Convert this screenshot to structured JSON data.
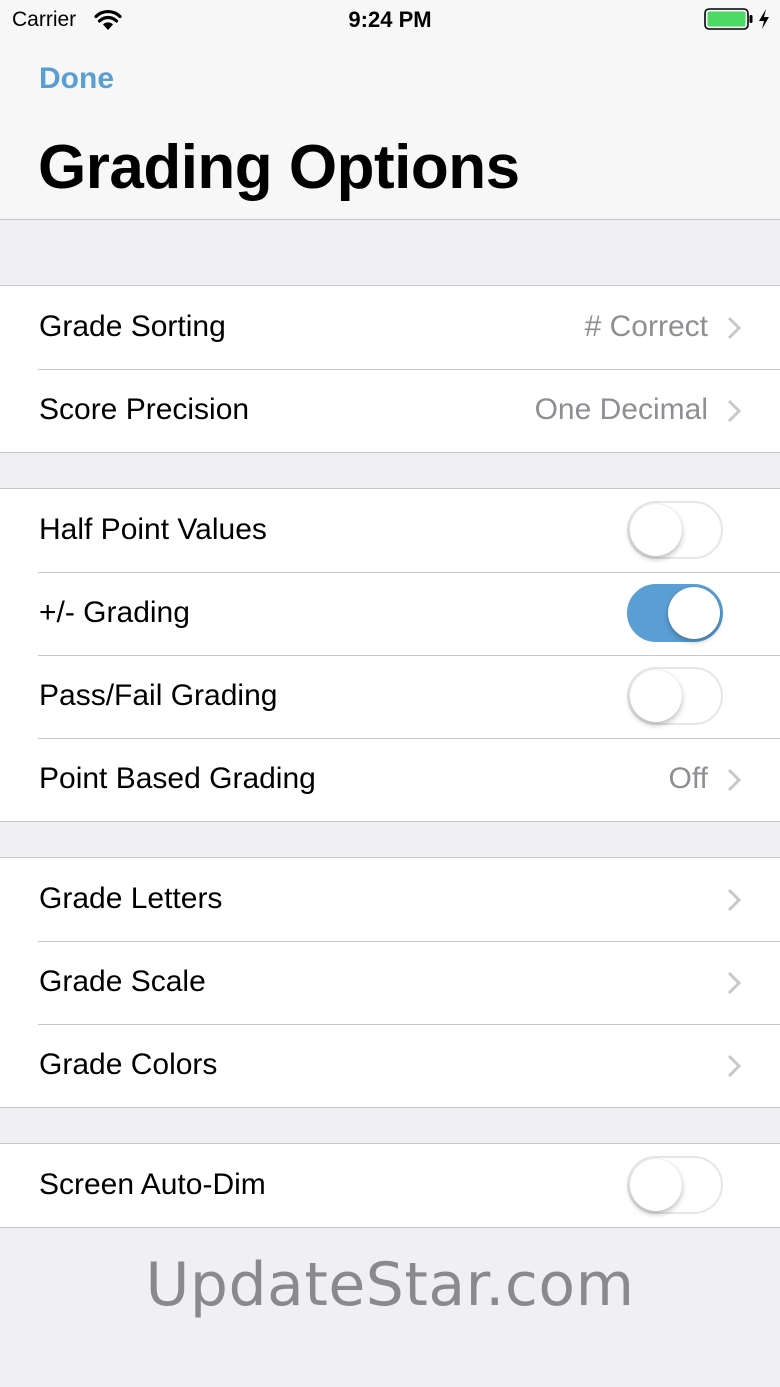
{
  "status_bar": {
    "carrier": "Carrier",
    "time": "9:24 PM"
  },
  "nav": {
    "done_label": "Done",
    "title": "Grading Options"
  },
  "groups": [
    {
      "rows": [
        {
          "label": "Grade Sorting",
          "value": "# Correct",
          "type": "disclosure"
        },
        {
          "label": "Score Precision",
          "value": "One Decimal",
          "type": "disclosure"
        }
      ]
    },
    {
      "rows": [
        {
          "label": "Half Point Values",
          "type": "switch",
          "on": false
        },
        {
          "label": "+/- Grading",
          "type": "switch",
          "on": true
        },
        {
          "label": "Pass/Fail Grading",
          "type": "switch",
          "on": false
        },
        {
          "label": "Point Based Grading",
          "value": "Off",
          "type": "disclosure"
        }
      ]
    },
    {
      "rows": [
        {
          "label": "Grade Letters",
          "type": "disclosure"
        },
        {
          "label": "Grade Scale",
          "type": "disclosure"
        },
        {
          "label": "Grade Colors",
          "type": "disclosure"
        }
      ]
    },
    {
      "rows": [
        {
          "label": "Screen Auto-Dim",
          "type": "switch",
          "on": false
        }
      ]
    }
  ],
  "watermark": "UpdateStar.com",
  "colors": {
    "accent": "#5a9fd4",
    "battery": "#4cd964",
    "secondary_text": "#8e8e93",
    "background": "#efeff4"
  },
  "icons": {
    "wifi": "wifi-icon",
    "battery": "battery-icon",
    "charging": "charging-bolt-icon",
    "chevron": "chevron-right-icon"
  }
}
